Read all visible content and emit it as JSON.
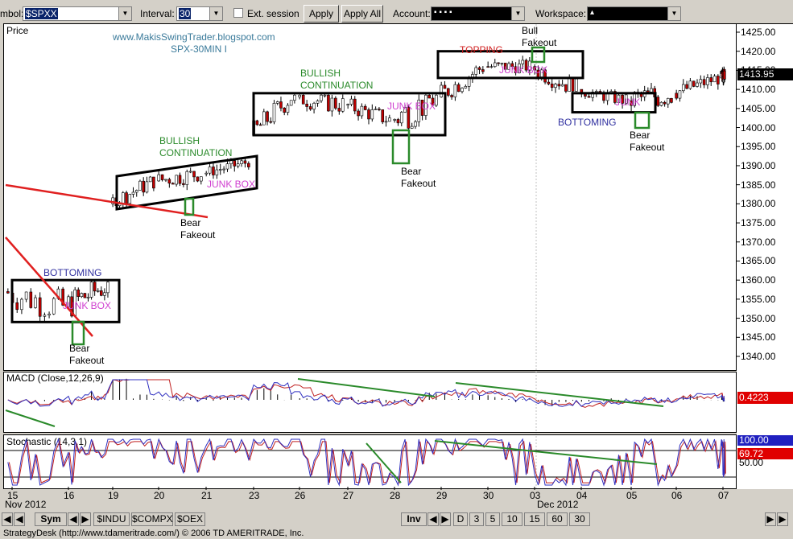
{
  "toolbar": {
    "symbol_label": "mbol:",
    "symbol_value": "$SPXX",
    "interval_label": "Interval:",
    "interval_value": "30",
    "ext_session_label": "Ext. session",
    "apply_label": "Apply",
    "apply_all_label": "Apply All",
    "account_label": "Account:",
    "account_value": "  ▪      ▪      ▪      ▪",
    "workspace_label": "Workspace:",
    "workspace_value": "▴"
  },
  "chart_data": {
    "type": "candlestick",
    "title": "SPX-30MIN I",
    "watermark": "www.MakisSwingTrader.blogspot.com",
    "price_panel_label": "Price",
    "last_price_label": "1413.95",
    "y_ticks": [
      "1425.00",
      "1420.00",
      "1415.00",
      "1410.00",
      "1405.00",
      "1400.00",
      "1395.00",
      "1390.00",
      "1385.00",
      "1380.00",
      "1375.00",
      "1370.00",
      "1365.00",
      "1360.00",
      "1355.00",
      "1350.00",
      "1345.00",
      "1340.00"
    ],
    "ylim": [
      1336,
      1428
    ],
    "x_day_labels": [
      "15",
      "16",
      "19",
      "20",
      "21",
      "23",
      "26",
      "27",
      "28",
      "29",
      "30",
      "03",
      "04",
      "05",
      "06",
      "07"
    ],
    "x_month_labels": [
      "Nov 2012",
      "Dec 2012"
    ],
    "segments": [
      {
        "day": "15",
        "open": 1357,
        "close": 1353,
        "high": 1366,
        "low": 1348
      },
      {
        "day": "16",
        "open": 1353,
        "close": 1359,
        "high": 1360,
        "low": 1344
      },
      {
        "day": "19",
        "open": 1380,
        "close": 1386,
        "high": 1388,
        "low": 1379
      },
      {
        "day": "20",
        "open": 1386,
        "close": 1388,
        "high": 1390,
        "low": 1381
      },
      {
        "day": "21",
        "open": 1388,
        "close": 1391,
        "high": 1392,
        "low": 1386
      },
      {
        "day": "23",
        "open": 1398,
        "close": 1409,
        "high": 1409,
        "low": 1397
      },
      {
        "day": "26",
        "open": 1408,
        "close": 1406,
        "high": 1409,
        "low": 1398
      },
      {
        "day": "27",
        "open": 1406,
        "close": 1402,
        "high": 1409,
        "low": 1400
      },
      {
        "day": "28",
        "open": 1402,
        "close": 1408,
        "high": 1409,
        "low": 1391
      },
      {
        "day": "29",
        "open": 1408,
        "close": 1416,
        "high": 1418,
        "low": 1407
      },
      {
        "day": "30",
        "open": 1416,
        "close": 1416,
        "high": 1419,
        "low": 1412
      },
      {
        "day": "03",
        "open": 1416,
        "close": 1410,
        "high": 1420,
        "low": 1409
      },
      {
        "day": "04",
        "open": 1410,
        "close": 1407,
        "high": 1410,
        "low": 1403
      },
      {
        "day": "05",
        "open": 1407,
        "close": 1409,
        "high": 1415,
        "low": 1400
      },
      {
        "day": "06",
        "open": 1409,
        "close": 1413,
        "high": 1414,
        "low": 1406
      },
      {
        "day": "07",
        "open": 1413,
        "close": 1414,
        "high": 1416,
        "low": 1409
      }
    ],
    "annotations": [
      {
        "text": "BOTTOMING",
        "color": "#3030a0"
      },
      {
        "text": "JUNK BOX",
        "color": "#d040d0"
      },
      {
        "text": "Bear\nFakeout",
        "color": "#000000"
      },
      {
        "text": "BULLISH\nCONTINUATION",
        "color": "#2a8a2a"
      },
      {
        "text": "JUNK BOX",
        "color": "#d040d0"
      },
      {
        "text": "Bear\nFakeout",
        "color": "#000000"
      },
      {
        "text": "BULLISH\nCONTINUATION",
        "color": "#2a8a2a"
      },
      {
        "text": "JUNK BOX",
        "color": "#d040d0"
      },
      {
        "text": "Bear\nFakeout",
        "color": "#000000"
      },
      {
        "text": "TOPPING",
        "color": "#d02020"
      },
      {
        "text": "JUNK BOX",
        "color": "#d040d0"
      },
      {
        "text": "Bull\nFakeout",
        "color": "#000000"
      },
      {
        "text": "BOTTOMING",
        "color": "#3030a0"
      },
      {
        "text": "JUNK",
        "color": "#d040d0"
      },
      {
        "text": "Bear\nFakeout",
        "color": "#000000"
      }
    ],
    "macd": {
      "label": "MACD (Close,12,26,9)",
      "value_label": "0.4223"
    },
    "stochastic": {
      "label": "Stochastic (14,3,1)",
      "value_label_1": "100.00",
      "value_label_2": "69.72",
      "level_label": "50.00"
    },
    "colors": {
      "up_candle": "#ffffff",
      "down_candle": "#c00000",
      "box": "#000000",
      "trend_red": "#e02020",
      "trend_green": "#2a8a2a",
      "macd": "#3030c0",
      "signal": "#c02020",
      "price_tag": "#000000",
      "macd_tag": "#e00000",
      "stoch_tag_1": "#2020c0",
      "stoch_tag_2": "#e00000"
    }
  },
  "bottom_bar": {
    "sym_label": "Sym",
    "tabs_left": [
      "$INDU",
      "$COMPX",
      "$OEX"
    ],
    "inv_label": "Inv",
    "tabs_right": [
      "D",
      "3",
      "5",
      "10",
      "15",
      "60",
      "30"
    ]
  },
  "status": "StrategyDesk (http://www.tdameritrade.com/) © 2006 TD AMERITRADE, Inc."
}
